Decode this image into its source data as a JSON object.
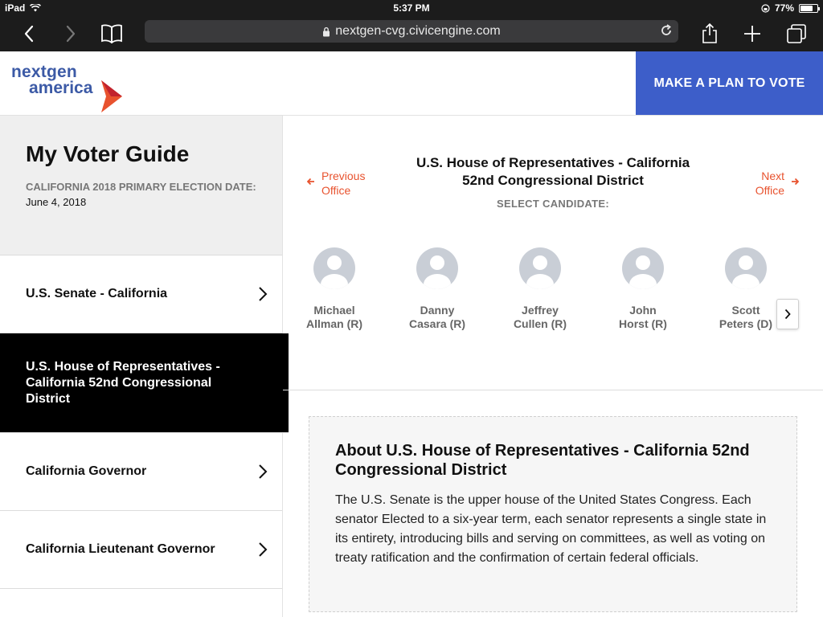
{
  "status_bar": {
    "device": "iPad",
    "time": "5:37 PM",
    "battery": "77%",
    "battery_level": 0.77
  },
  "browser": {
    "url": "nextgen-cvg.civicengine.com"
  },
  "header": {
    "logo_line1": "nextgen",
    "logo_line2": "america",
    "cta_label": "MAKE A PLAN TO VOTE",
    "brand_color": "#3c5aa6",
    "cta_color": "#3d5ec9",
    "accent_color": "#e8522e"
  },
  "sidebar": {
    "title": "My Voter Guide",
    "election": "CALIFORNIA 2018 PRIMARY ELECTION DATE:",
    "date": "June 4, 2018",
    "items": [
      {
        "label": "U.S. Senate - California",
        "active": false
      },
      {
        "label": "U.S. House of Representatives - California 52nd Congressional District",
        "active": true
      },
      {
        "label": "California Governor",
        "active": false
      },
      {
        "label": "California Lieutenant Governor",
        "active": false
      }
    ]
  },
  "office": {
    "prev_label_1": "Previous",
    "prev_label_2": "Office",
    "next_label_1": "Next",
    "next_label_2": "Office",
    "title_line1": "U.S. House of Representatives - California",
    "title_line2": "52nd Congressional District",
    "select_label": "SELECT CANDIDATE:"
  },
  "candidates": [
    {
      "first": "Michael",
      "last": "Allman (R)"
    },
    {
      "first": "Danny",
      "last": "Casara (R)"
    },
    {
      "first": "Jeffrey",
      "last": "Cullen (R)"
    },
    {
      "first": "John",
      "last": "Horst (R)"
    },
    {
      "first": "Scott",
      "last": "Peters (D)"
    }
  ],
  "about": {
    "heading": "About U.S. House of Representatives - California 52nd Congressional District",
    "body": "The U.S. Senate is the upper house of the United States Congress. Each senator Elected to a six-year term, each senator represents a single state in its entirety, introducing bills and serving on committees, as well as voting on treaty ratification and the confirmation of certain federal officials."
  }
}
